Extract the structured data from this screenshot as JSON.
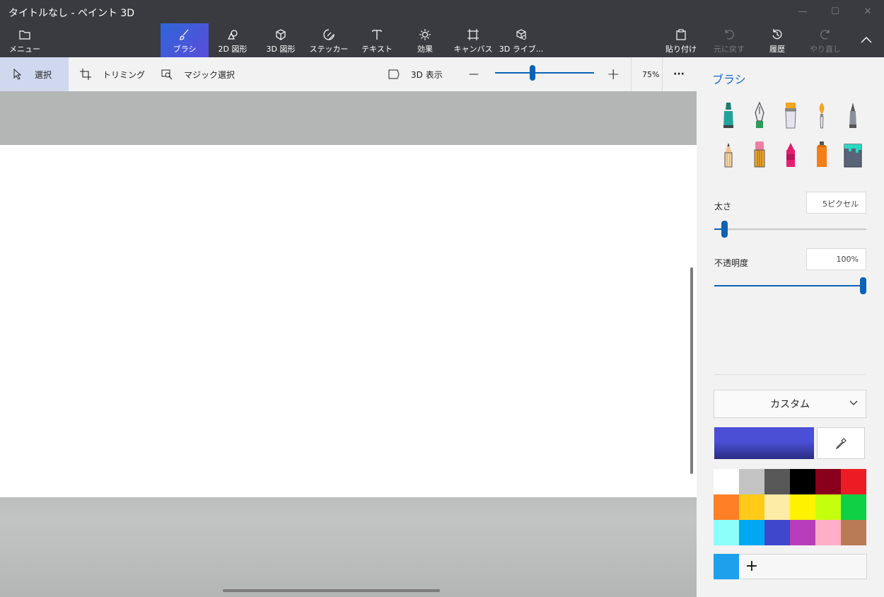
{
  "window": {
    "title": "タイトルなし - ペイント 3D",
    "controls": [
      "minimize-icon",
      "maximize-icon",
      "close-icon"
    ]
  },
  "ribbon": {
    "menu": "メニュー",
    "tabs": [
      {
        "label": "ブラシ",
        "icon": "brush-icon",
        "active": true
      },
      {
        "label": "2D 図形",
        "icon": "2d-shapes-icon"
      },
      {
        "label": "3D 図形",
        "icon": "3d-shapes-icon"
      },
      {
        "label": "ステッカー",
        "icon": "sticker-icon"
      },
      {
        "label": "テキスト",
        "icon": "text-icon"
      },
      {
        "label": "効果",
        "icon": "effects-icon"
      },
      {
        "label": "キャンバス",
        "icon": "canvas-icon"
      },
      {
        "label": "3D ライブ...",
        "icon": "3d-library-icon"
      }
    ],
    "paste": "貼り付け",
    "undo": "元に戻す",
    "history": "履歴",
    "redo": "やり直し",
    "accent": "#3a5fd9"
  },
  "toolbar": {
    "select": "選択",
    "crop": "トリミング",
    "magic_select": "マジック選択",
    "view3d": "3D 表示",
    "zoom_minus": "—",
    "zoom_plus": "+",
    "zoom_level": "75%",
    "more": "···",
    "zoom_fraction": 0.37
  },
  "panel": {
    "title": "ブラシ",
    "brushes": [
      "marker-icon",
      "calligraphy-pen-icon",
      "oil-brush-icon",
      "watercolor-icon",
      "pixel-pen-icon",
      "pencil-icon",
      "eraser-icon",
      "crayon-icon",
      "spray-can-icon",
      "fill-bucket-icon"
    ],
    "thickness_label": "太さ",
    "thickness_value": "5ピクセル",
    "thickness_fraction": 0.05,
    "opacity_label": "不透明度",
    "opacity_value": "100%",
    "opacity_fraction": 1.0,
    "finish": "カスタム",
    "current_color": "#4a4fd6",
    "palette": [
      "#ffffff",
      "#c3c3c3",
      "#585858",
      "#000000",
      "#88001b",
      "#ec1c24",
      "#ff7f27",
      "#ffca18",
      "#fdeca6",
      "#fff200",
      "#c4ff0e",
      "#0ed145",
      "#8cfffb",
      "#00a8f3",
      "#3f48cc",
      "#b83dba",
      "#ffaec8",
      "#b97a56"
    ],
    "custom_color": "#1ea0ec",
    "add": "+"
  }
}
